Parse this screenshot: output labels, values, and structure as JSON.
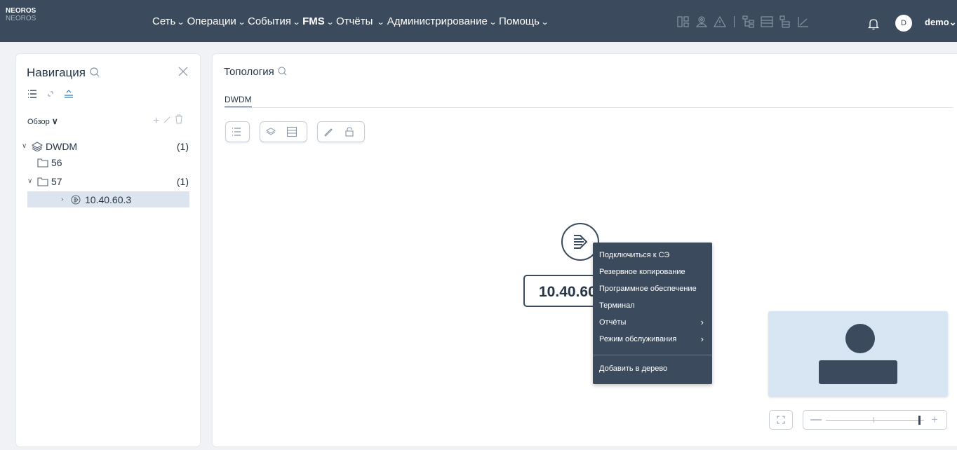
{
  "brand": {
    "name": "NEOROS",
    "sub": "NEOROS"
  },
  "menu": [
    {
      "label": "Сеть",
      "bold": false
    },
    {
      "label": "Операции",
      "bold": false
    },
    {
      "label": "События",
      "bold": false
    },
    {
      "label": "FMS",
      "bold": true
    },
    {
      "label": "Отчёты",
      "bold": false
    },
    {
      "label": "Администрирование",
      "bold": false
    },
    {
      "label": "Помощь",
      "bold": false
    }
  ],
  "user": {
    "initial": "D",
    "name": "demo"
  },
  "navigation": {
    "title": "Навигация",
    "overview_label": "Обзор",
    "tree": [
      {
        "label": "DWDM",
        "count": "(1)"
      },
      {
        "label": "56",
        "count": ""
      },
      {
        "label": "57",
        "count": "(1)"
      },
      {
        "label": "10.40.60.3",
        "count": ""
      }
    ]
  },
  "topology": {
    "title": "Топология",
    "tab": "DWDM",
    "node_label": "10.40.60.3"
  },
  "context_menu": {
    "items": [
      {
        "label": "Подключиться к СЭ",
        "submenu": false
      },
      {
        "label": "Резервное копирование",
        "submenu": false
      },
      {
        "label": "Программное обеспечение",
        "submenu": false
      },
      {
        "label": "Терминал",
        "submenu": false
      },
      {
        "label": "Отчёты",
        "submenu": true
      },
      {
        "label": "Режим обслуживания",
        "submenu": true
      }
    ],
    "extra": {
      "label": "Добавить в дерево"
    }
  },
  "zoom": {
    "level_fraction": 0.95
  },
  "colors": {
    "header": "#3b4a5c",
    "selected_row": "#dce5ef",
    "minimap": "#d8e6f3"
  }
}
